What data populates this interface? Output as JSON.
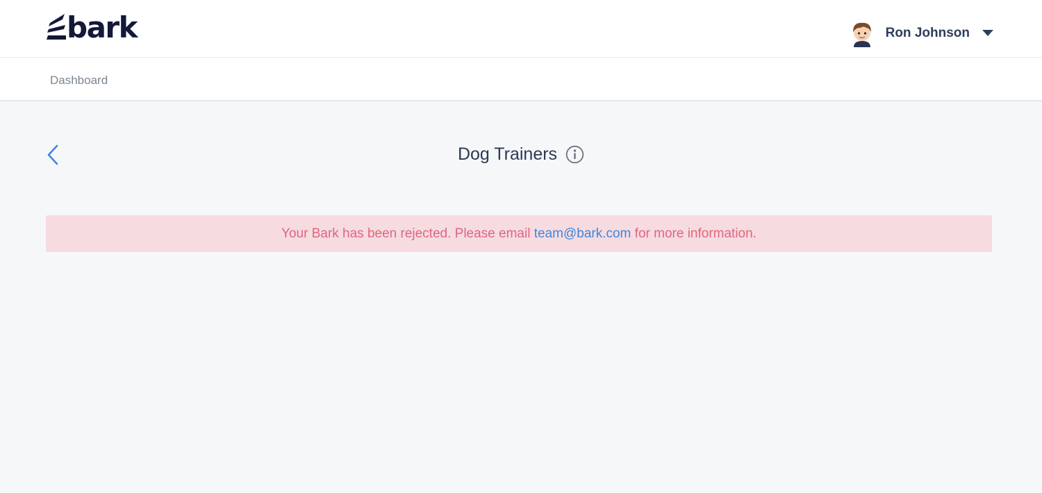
{
  "header": {
    "logo_text": "bark",
    "user": {
      "name": "Ron Johnson"
    }
  },
  "nav": {
    "dashboard_label": "Dashboard"
  },
  "page": {
    "title": "Dog Trainers"
  },
  "alert": {
    "text_before": "Your Bark has been rejected. Please email ",
    "email": "team@bark.com",
    "text_after": " for more information."
  },
  "icons": {
    "logo": "bark-logo-mark",
    "avatar": "user-avatar",
    "user_menu_caret": "caret-down-icon",
    "back": "chevron-left-icon",
    "info": "info-circle-icon"
  },
  "colors": {
    "brand_dark": "#14193a",
    "accent_blue": "#3f87d9",
    "alert_bg": "#f6dbe1",
    "alert_text": "#e0667c",
    "page_bg": "#f6f7f9"
  }
}
